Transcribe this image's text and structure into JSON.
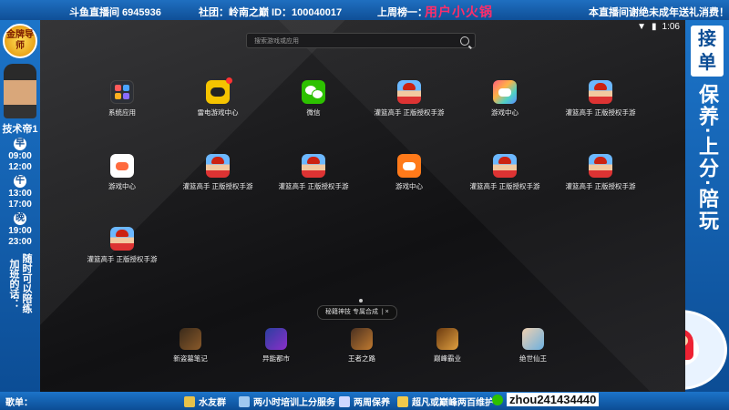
{
  "top_bar": {
    "room": "斗鱼直播间 6945936",
    "club": "社团：岭南之巅 ID：100040017",
    "rank_label": "上周榜一：",
    "rank_user": "用户小火锅",
    "notice": "本直播间谢绝未成年送礼消费！"
  },
  "left_bar": {
    "logo": "金牌导师",
    "title": "技术帝1",
    "shifts": [
      {
        "tag": "早",
        "start": "09:00",
        "end": "12:00"
      },
      {
        "tag": "午",
        "start": "13:00",
        "end": "17:00"
      },
      {
        "tag": "晚",
        "start": "19:00",
        "end": "23:00"
      }
    ],
    "slogan_col1": "加班的话：",
    "slogan_col2": "随时可以陪练"
  },
  "right_bar": {
    "badge": "接单",
    "services": "保养·上分·陪玩"
  },
  "bottom_bar": {
    "song_label": "歌单：",
    "items": [
      {
        "label": "水友群",
        "icon": "group-icon",
        "color": "#e8c24a"
      },
      {
        "label": "两小时培训上分服务",
        "icon": "training-icon",
        "color": "#9ec8f0"
      },
      {
        "label": "两周保养",
        "icon": "rocket-icon",
        "color": "#d0d8ff"
      },
      {
        "label": "超凡或巅峰两百维护",
        "icon": "crown-icon",
        "color": "#f2c94c"
      },
      {
        "label": "zhou241434440",
        "icon": "wechat-icon",
        "color": "#2dc100"
      }
    ]
  },
  "phone": {
    "status_time": "1:06",
    "search_placeholder": "搜索游戏或应用",
    "apps_row1": [
      {
        "label": "系统应用",
        "icon": "folder-icon"
      },
      {
        "label": "雷电游戏中心",
        "icon": "leidian-game-center-icon"
      },
      {
        "label": "微信",
        "icon": "wechat-icon"
      },
      {
        "label": "灌篮高手 正版授权手游",
        "icon": "slam-dunk-icon"
      },
      {
        "label": "游戏中心",
        "icon": "game-center-icon"
      },
      {
        "label": "灌篮高手 正版授权手游",
        "icon": "slam-dunk-icon"
      }
    ],
    "apps_row2": [
      {
        "label": "游戏中心",
        "icon": "game-center-icon"
      },
      {
        "label": "灌篮高手 正版授权手游",
        "icon": "slam-dunk-icon"
      },
      {
        "label": "灌篮高手 正版授权手游",
        "icon": "slam-dunk-icon"
      },
      {
        "label": "游戏中心",
        "icon": "game-center-icon"
      },
      {
        "label": "灌篮高手 正版授权手游",
        "icon": "slam-dunk-icon"
      },
      {
        "label": "灌篮高手 正版授权手游",
        "icon": "slam-dunk-icon"
      }
    ],
    "apps_row3": [
      {
        "label": "灌篮高手 正版授权手游",
        "icon": "slam-dunk-icon"
      }
    ],
    "toast": "秘籍神技 专属合成",
    "dock": [
      {
        "label": "新盗墓笔记",
        "icon": "tomb-notes-icon"
      },
      {
        "label": "异能都市",
        "icon": "esper-city-icon"
      },
      {
        "label": "王者之路",
        "icon": "kings-road-icon"
      },
      {
        "label": "巅峰霸业",
        "icon": "peak-hegemony-icon"
      },
      {
        "label": "绝世仙王",
        "icon": "immortal-king-icon"
      }
    ]
  }
}
